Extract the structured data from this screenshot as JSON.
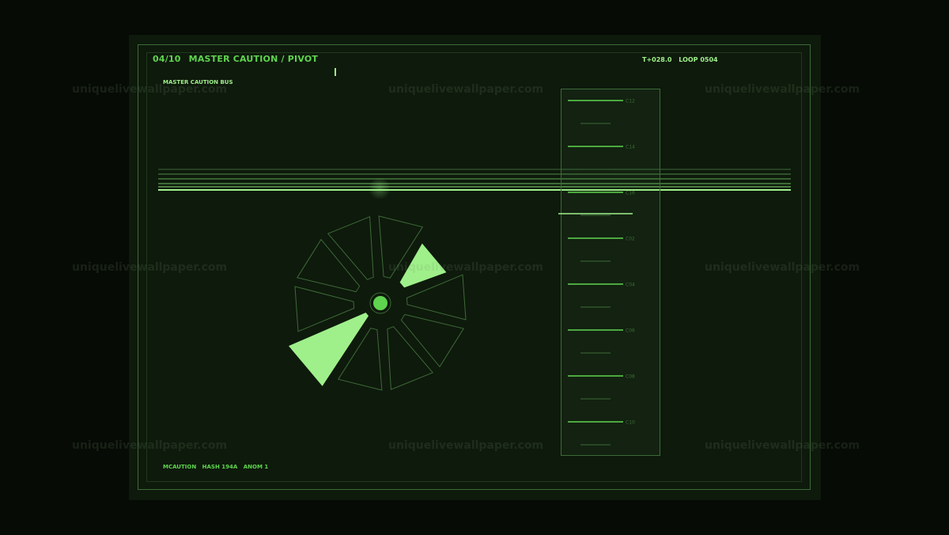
{
  "header": {
    "index": "04/10",
    "title": "MASTER CAUTION / PIVOT",
    "timer": "T+028.0",
    "loop": "LOOP 0504"
  },
  "bus": {
    "label": "MASTER CAUTION BUS"
  },
  "footer": {
    "code": "MCAUTION",
    "hash": "HASH 194A",
    "anom": "ANOM 1"
  },
  "scale": {
    "labels": [
      "C12",
      "C14",
      "C16",
      "C02",
      "C04",
      "C06",
      "C08",
      "C10"
    ]
  },
  "pivot": {
    "segment_count": 10,
    "active_segments": [
      1,
      6
    ]
  },
  "watermark": {
    "text": "uniquelivewallpaper.com"
  },
  "colors": {
    "bright": "#9ff08a",
    "accent": "#5fd44f",
    "dim": "#3d6a37",
    "panel": "#0e1a0c"
  }
}
